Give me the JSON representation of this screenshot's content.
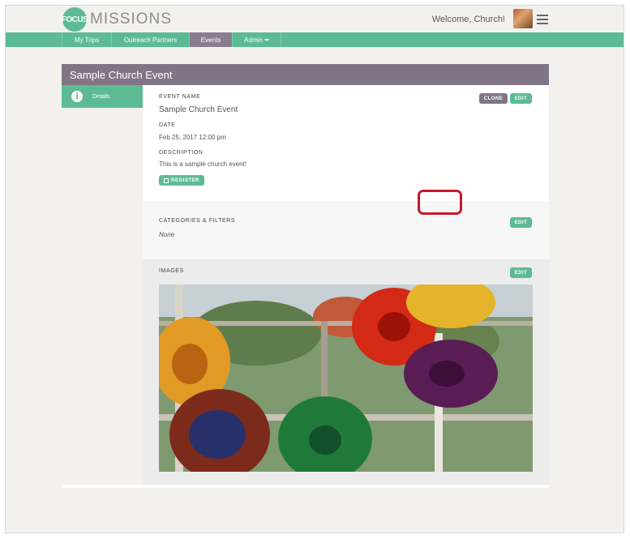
{
  "header": {
    "logo_mark": "FOCUS",
    "logo_word": "MISSIONS",
    "welcome": "Welcome, Church!",
    "avatar_icon": "user-avatar",
    "menu_icon": "hamburger-icon"
  },
  "nav": {
    "items": [
      {
        "label": "My Trips",
        "active": false
      },
      {
        "label": "Outreach Partners",
        "active": false
      },
      {
        "label": "Events",
        "active": true
      },
      {
        "label": "Admin",
        "active": false,
        "dropdown": true
      }
    ]
  },
  "event": {
    "title": "Sample Church Event",
    "sidebar": {
      "label": "Details",
      "icon": "info-icon"
    },
    "fields": {
      "name_label": "EVENT NAME",
      "name_value": "Sample Church Event",
      "date_label": "DATE",
      "date_value": "Feb 25, 2017 12:00 pm",
      "desc_label": "DESCRIPTION",
      "desc_value": "This is a sample church event!"
    },
    "buttons": {
      "clone": "CLONE",
      "edit": "EDIT",
      "register": "REGISTER"
    },
    "categories": {
      "label": "CATEGORIES & FILTERS",
      "value": "None",
      "edit": "EDIT"
    },
    "images": {
      "label": "IMAGES",
      "edit": "EDIT"
    }
  },
  "colors": {
    "accent_green": "#5dbb94",
    "accent_purple": "#817585",
    "highlight_red": "#c5192d"
  }
}
